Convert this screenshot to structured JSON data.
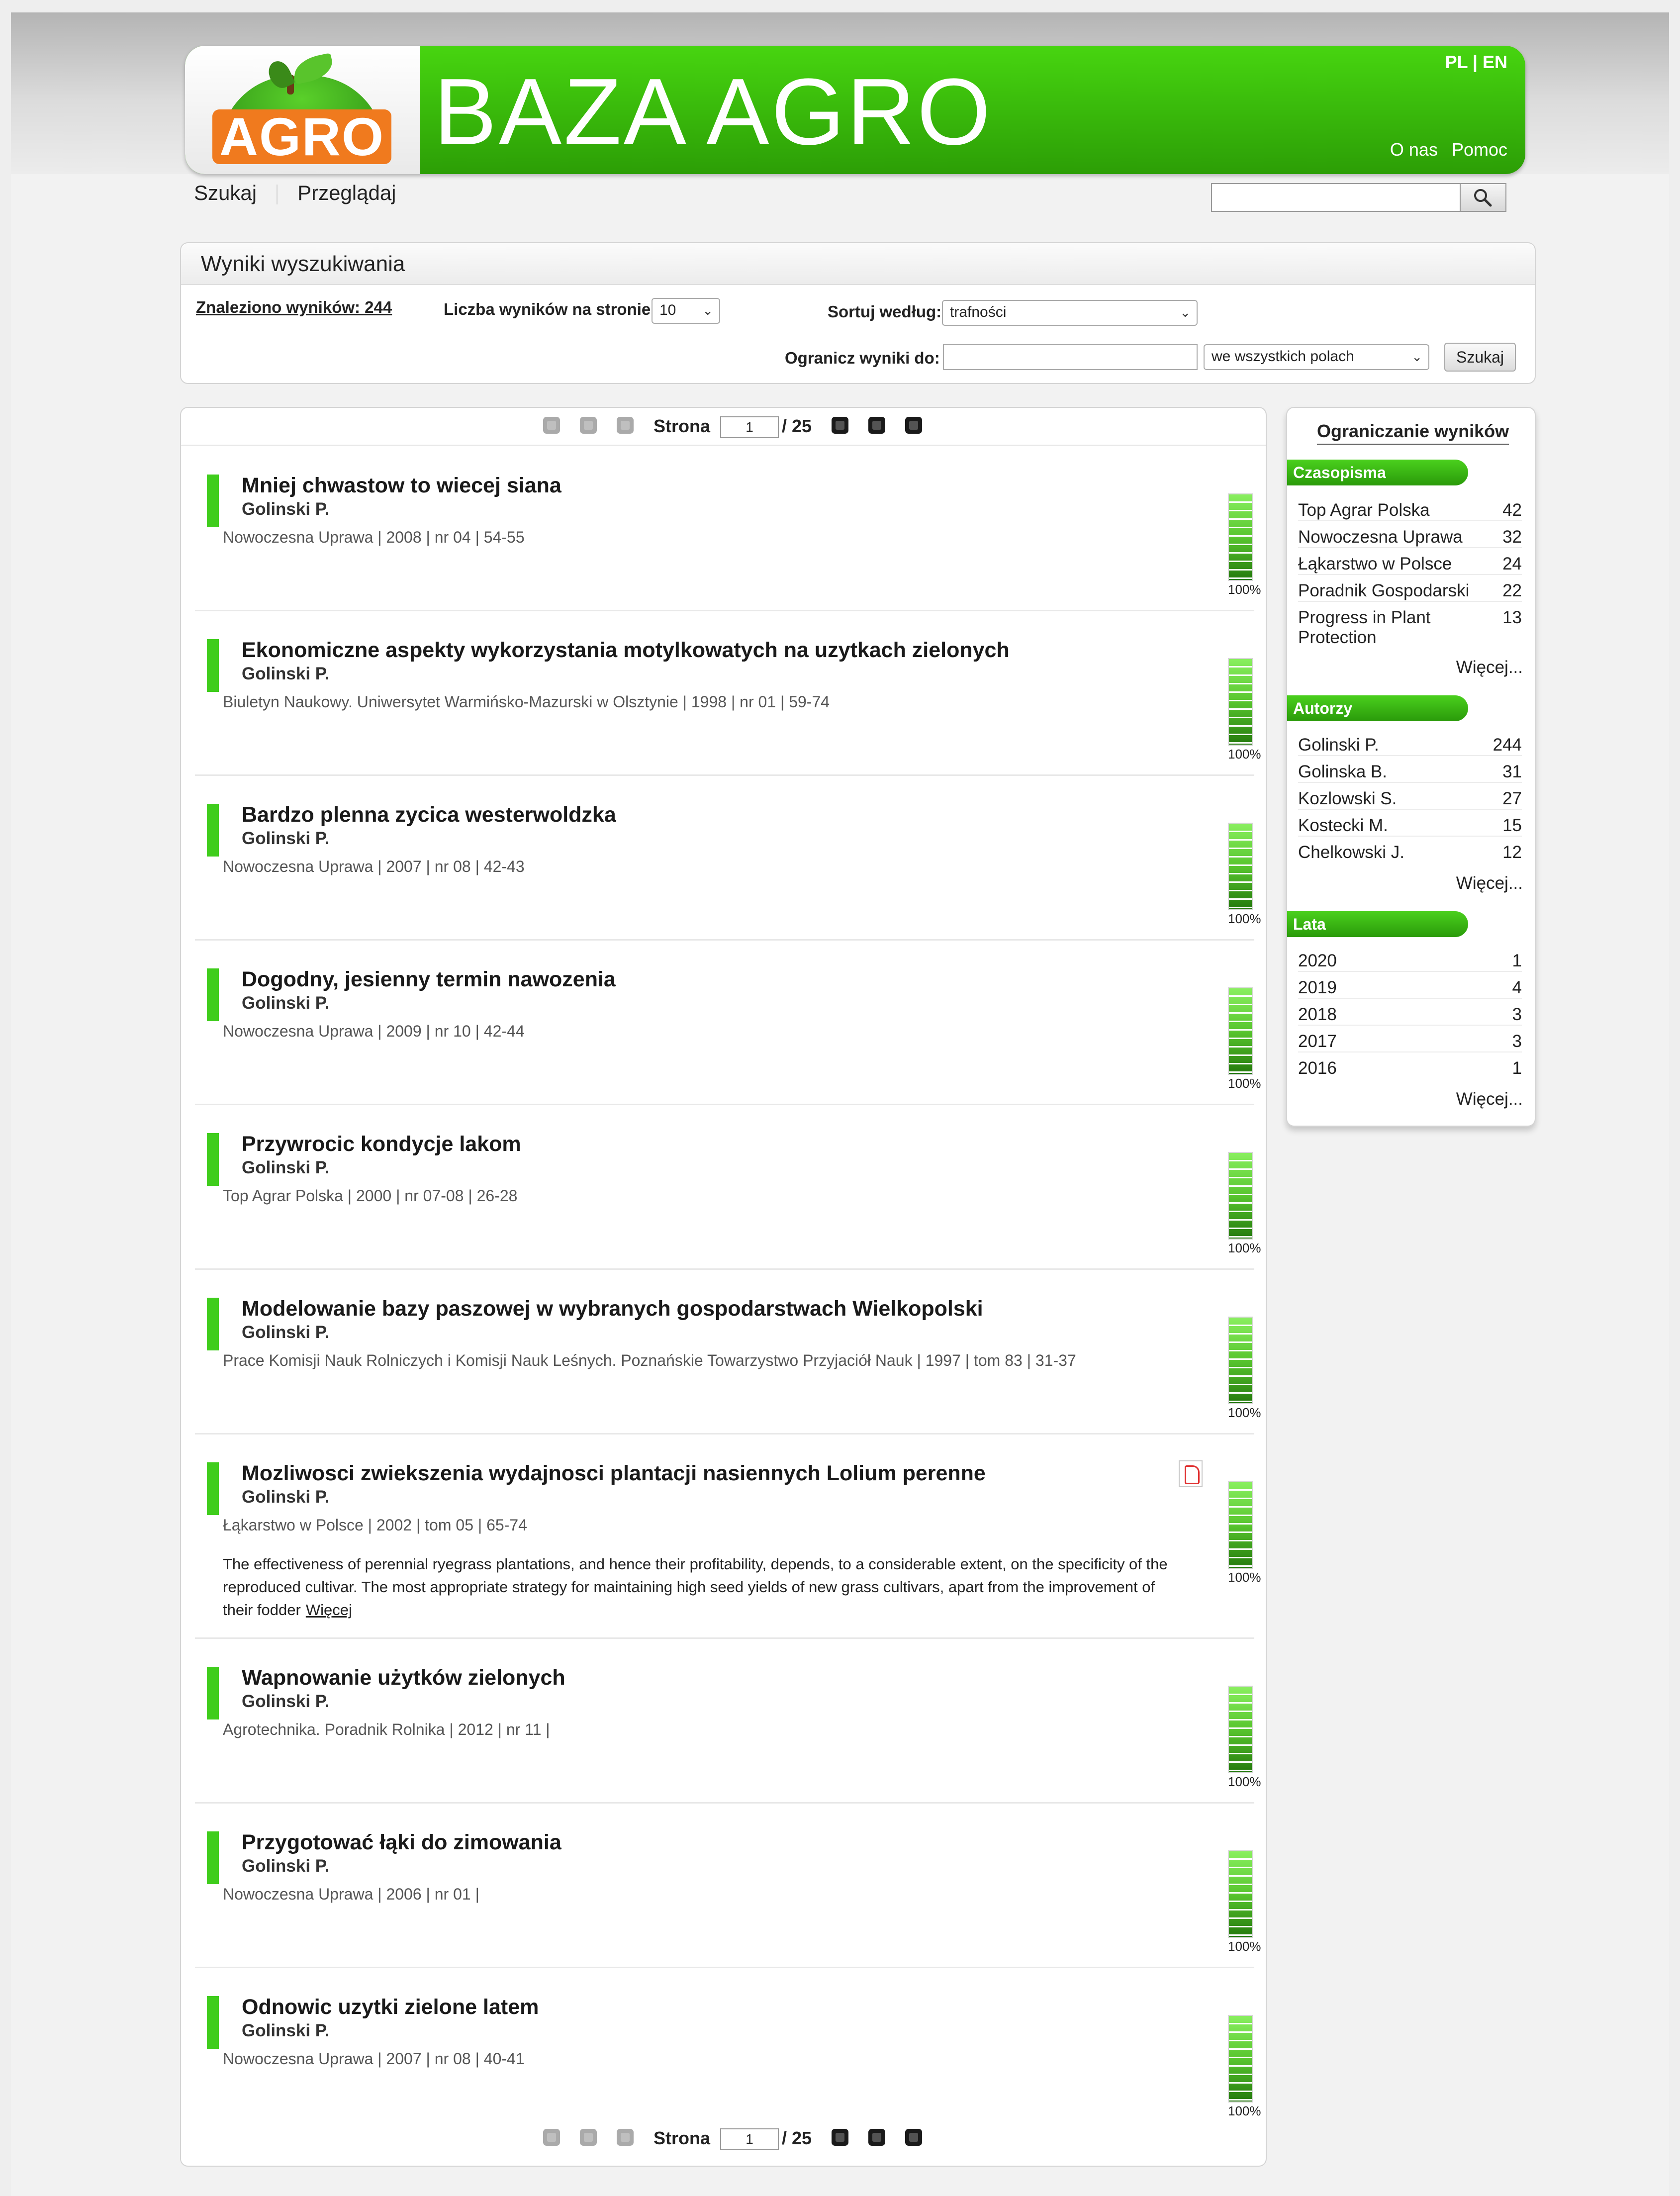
{
  "header": {
    "logo_text": "AGRO",
    "brand": "BAZA AGRO",
    "lang": "PL | EN",
    "links": [
      "O nas",
      "Pomoc"
    ]
  },
  "nav": {
    "search": "Szukaj",
    "browse": "Przeglądaj"
  },
  "search": {
    "placeholder": "",
    "icon": "magnifier-icon"
  },
  "results_panel": {
    "title": "Wyniki wyszukiwania",
    "found": "Znaleziono wyników: 244",
    "per_page_label": "Liczba wyników na stronie",
    "per_page_value": "10",
    "sort_label": "Sortuj według:",
    "sort_value": "trafności",
    "limit_label": "Ogranicz wyniki do:",
    "limit_value": "",
    "field_value": "we wszystkich polach",
    "search_button": "Szukaj"
  },
  "pager": {
    "label": "Strona",
    "current": "1",
    "total": "/ 25"
  },
  "results": [
    {
      "title": "Mniej chwastow to wiecej siana",
      "author": "Golinski P.",
      "meta": "Nowoczesna Uprawa   |  2008  |  nr 04  |  54-55",
      "relevance": "100%",
      "relevance_value": 1.0
    },
    {
      "title": "Ekonomiczne aspekty wykorzystania motylkowatych na uzytkach zielonych",
      "author": "Golinski P.",
      "meta": "Biuletyn Naukowy. Uniwersytet Warmińsko-Mazurski w Olsztynie   |  1998  |  nr 01  |  59-74",
      "relevance": "100%",
      "relevance_value": 1.0
    },
    {
      "title": "Bardzo plenna zycica westerwoldzka",
      "author": "Golinski P.",
      "meta": "Nowoczesna Uprawa   |  2007  |  nr 08  |  42-43",
      "relevance": "100%",
      "relevance_value": 1.0
    },
    {
      "title": "Dogodny, jesienny termin nawozenia",
      "author": "Golinski P.",
      "meta": "Nowoczesna Uprawa   |  2009  |  nr 10  |  42-44",
      "relevance": "100%",
      "relevance_value": 1.0
    },
    {
      "title": "Przywrocic kondycje lakom",
      "author": "Golinski P.",
      "meta": "Top Agrar Polska   |  2000  |  nr 07-08  |  26-28",
      "relevance": "100%",
      "relevance_value": 1.0
    },
    {
      "title": "Modelowanie bazy paszowej w wybranych gospodarstwach Wielkopolski",
      "author": "Golinski P.",
      "meta": "Prace Komisji Nauk Rolniczych i Komisji Nauk Leśnych. Poznańskie Towarzystwo Przyjaciół Nauk   |  1997  |  tom 83  |  31-37",
      "relevance": "100%",
      "relevance_value": 1.0
    },
    {
      "title": "Mozliwosci zwiekszenia wydajnosci plantacji nasiennych Lolium perenne",
      "author": "Golinski P.",
      "meta": "Łąkarstwo w Polsce   |  2002  |  tom 05  |  65-74",
      "abstract": "The effectiveness of perennial ryegrass plantations, and hence their profitability, depends, to a considerable extent, on the specificity of the reproduced cultivar. The most appropriate strategy for maintaining high seed yields of new grass cultivars, apart from the improvement of their fodder",
      "more": "Więcej",
      "pdf": true,
      "relevance": "100%",
      "relevance_value": 1.0
    },
    {
      "title": "Wapnowanie użytków zielonych",
      "author": "Golinski P.",
      "meta": "Agrotechnika. Poradnik Rolnika   |  2012  |  nr 11  |",
      "relevance": "100%",
      "relevance_value": 1.0
    },
    {
      "title": "Przygotować łąki do zimowania",
      "author": "Golinski P.",
      "meta": "Nowoczesna Uprawa   |  2006  |  nr 01  |",
      "relevance": "100%",
      "relevance_value": 1.0
    },
    {
      "title": "Odnowic uzytki zielone latem",
      "author": "Golinski P.",
      "meta": "Nowoczesna Uprawa   |  2007  |  nr 08  |  40-41",
      "relevance": "100%",
      "relevance_value": 1.0
    }
  ],
  "facets": {
    "title": "Ograniczanie wyników",
    "more": "Więcej...",
    "groups": [
      {
        "name": "Czasopisma",
        "items": [
          {
            "label": "Top Agrar Polska",
            "count": "42"
          },
          {
            "label": "Nowoczesna Uprawa",
            "count": "32"
          },
          {
            "label": "Łąkarstwo w Polsce",
            "count": "24"
          },
          {
            "label": "Poradnik Gospodarski",
            "count": "22"
          },
          {
            "label": "Progress in Plant Protection",
            "count": "13"
          }
        ]
      },
      {
        "name": "Autorzy",
        "items": [
          {
            "label": "Golinski P.",
            "count": "244"
          },
          {
            "label": "Golinska B.",
            "count": "31"
          },
          {
            "label": "Kozlowski S.",
            "count": "27"
          },
          {
            "label": "Kostecki M.",
            "count": "15"
          },
          {
            "label": "Chelkowski J.",
            "count": "12"
          }
        ]
      },
      {
        "name": "Lata",
        "items": [
          {
            "label": "2020",
            "count": "1"
          },
          {
            "label": "2019",
            "count": "4"
          },
          {
            "label": "2018",
            "count": "3"
          },
          {
            "label": "2017",
            "count": "3"
          },
          {
            "label": "2016",
            "count": "1"
          }
        ]
      }
    ]
  },
  "colors": {
    "accent_green": "#3fcd1c",
    "logo_orange": "#f07a1e"
  }
}
